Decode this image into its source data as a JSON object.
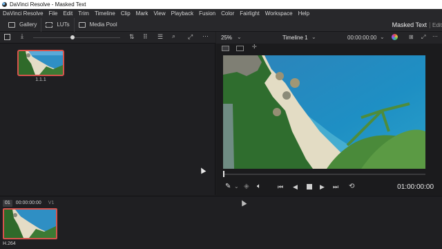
{
  "window": {
    "title": "DaVinci Resolve - Masked Text"
  },
  "menu": [
    "DaVinci Resolve",
    "File",
    "Edit",
    "Trim",
    "Timeline",
    "Clip",
    "Mark",
    "View",
    "Playback",
    "Fusion",
    "Color",
    "Fairlight",
    "Workspace",
    "Help"
  ],
  "toolbar": {
    "gallery_label": "Gallery",
    "luts_label": "LUTs",
    "media_pool_label": "Media Pool",
    "page_name": "Masked Text",
    "edit_tab": "Edit"
  },
  "gallery": {
    "still_label": "1.1.1",
    "slider_value": 0.45
  },
  "viewer": {
    "zoom": "25%",
    "timeline_name": "Timeline 1",
    "header_timecode": "00:00:00:00",
    "timecode": "01:00:00:00",
    "playhead_fraction": 0.0
  },
  "clips": {
    "index": "01",
    "timecode": "00:00:00:00",
    "track": "V1",
    "codec": "H.264"
  },
  "colors": {
    "selection_border": "#d8534d",
    "panel_bg": "#1f1f22",
    "titlebar_bg": "#ffffff"
  }
}
